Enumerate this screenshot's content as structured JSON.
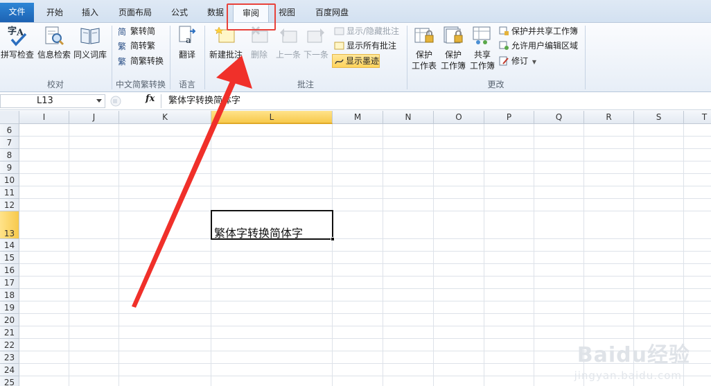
{
  "tabs": {
    "file": "文件",
    "items": [
      "开始",
      "插入",
      "页面布局",
      "公式",
      "数据",
      "审阅",
      "视图",
      "百度网盘"
    ],
    "active": "审阅"
  },
  "ribbon": {
    "proofing": {
      "label": "校对",
      "spell": "拼写检查",
      "research": "信息检索",
      "thesaurus": "同义词库"
    },
    "chinese": {
      "label": "中文简繁转换",
      "to_traditional": "繁转简",
      "to_simplified": "简转繁",
      "convert": "简繁转换"
    },
    "language": {
      "label": "语言",
      "translate": "翻译"
    },
    "comments": {
      "label": "批注",
      "new": "新建批注",
      "delete": "删除",
      "prev": "上一条",
      "next": "下一条",
      "show_hide": "显示/隐藏批注",
      "show_all": "显示所有批注",
      "show_ink": "显示墨迹"
    },
    "changes": {
      "label": "更改",
      "protect_sheet_1": "保护",
      "protect_sheet_2": "工作表",
      "protect_workbook_1": "保护",
      "protect_workbook_2": "工作簿",
      "share_workbook_1": "共享",
      "share_workbook_2": "工作簿",
      "protect_share": "保护并共享工作簿",
      "allow_edit": "允许用户编辑区域",
      "track": "修订"
    }
  },
  "formula_bar": {
    "name_box": "L13",
    "fx": "fx",
    "content": "繁体字转换简体字"
  },
  "grid": {
    "columns": [
      "I",
      "J",
      "K",
      "L",
      "M",
      "N",
      "O",
      "P",
      "Q",
      "R",
      "S",
      "T"
    ],
    "selected_column": "L",
    "rows": [
      "6",
      "7",
      "8",
      "9",
      "10",
      "11",
      "12",
      "13",
      "14",
      "15",
      "16",
      "17",
      "18",
      "19",
      "20",
      "21",
      "22",
      "23",
      "24",
      "25"
    ],
    "selected_row": "13",
    "active_cell_text": "繁体字转换简体字"
  },
  "watermark": {
    "brand": "Baidu经验",
    "url": "jingyan.baidu.com"
  },
  "colors": {
    "file_tab": "#1d62b3",
    "highlight_box": "#e8413a",
    "arrow": "#f0302a",
    "selected_header": "#f7c94c"
  }
}
